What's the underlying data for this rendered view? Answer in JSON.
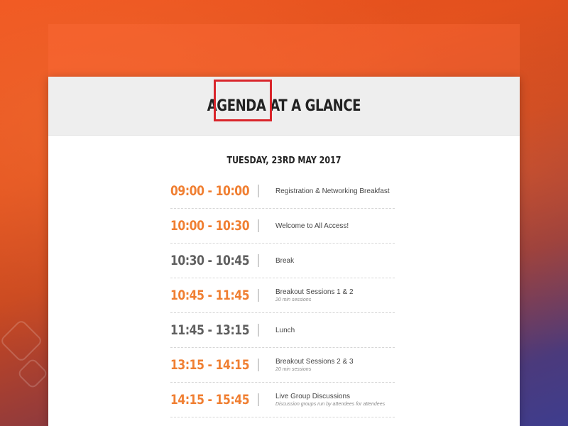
{
  "header": {
    "title": "AGENDA AT A GLANCE"
  },
  "date": "TUESDAY, 23RD MAY 2017",
  "agenda": [
    {
      "time": "09:00 - 10:00",
      "title": "Registration & Networking Breakfast",
      "note": "",
      "color": "#f07f32"
    },
    {
      "time": "10:00 - 10:30",
      "title": "Welcome to All Access!",
      "note": "",
      "color": "#f07f32"
    },
    {
      "time": "10:30 - 10:45",
      "title": "Break",
      "note": "",
      "color": "#5f5f5f"
    },
    {
      "time": "10:45 - 11:45",
      "title": "Breakout Sessions 1 & 2",
      "note": "20 min sessions",
      "color": "#f07f32"
    },
    {
      "time": "11:45 - 13:15",
      "title": "Lunch",
      "note": "",
      "color": "#5f5f5f"
    },
    {
      "time": "13:15 - 14:15",
      "title": "Breakout Sessions 2 & 3",
      "note": "20 min sessions",
      "color": "#f07f32"
    },
    {
      "time": "14:15 - 15:45",
      "title": "Live Group Discussions",
      "note": "Discussion groups run by attendees for attendees",
      "color": "#f07f32"
    }
  ],
  "colors": {
    "accent": "#f07f32",
    "muted": "#5f5f5f",
    "highlight": "#d9252b"
  }
}
